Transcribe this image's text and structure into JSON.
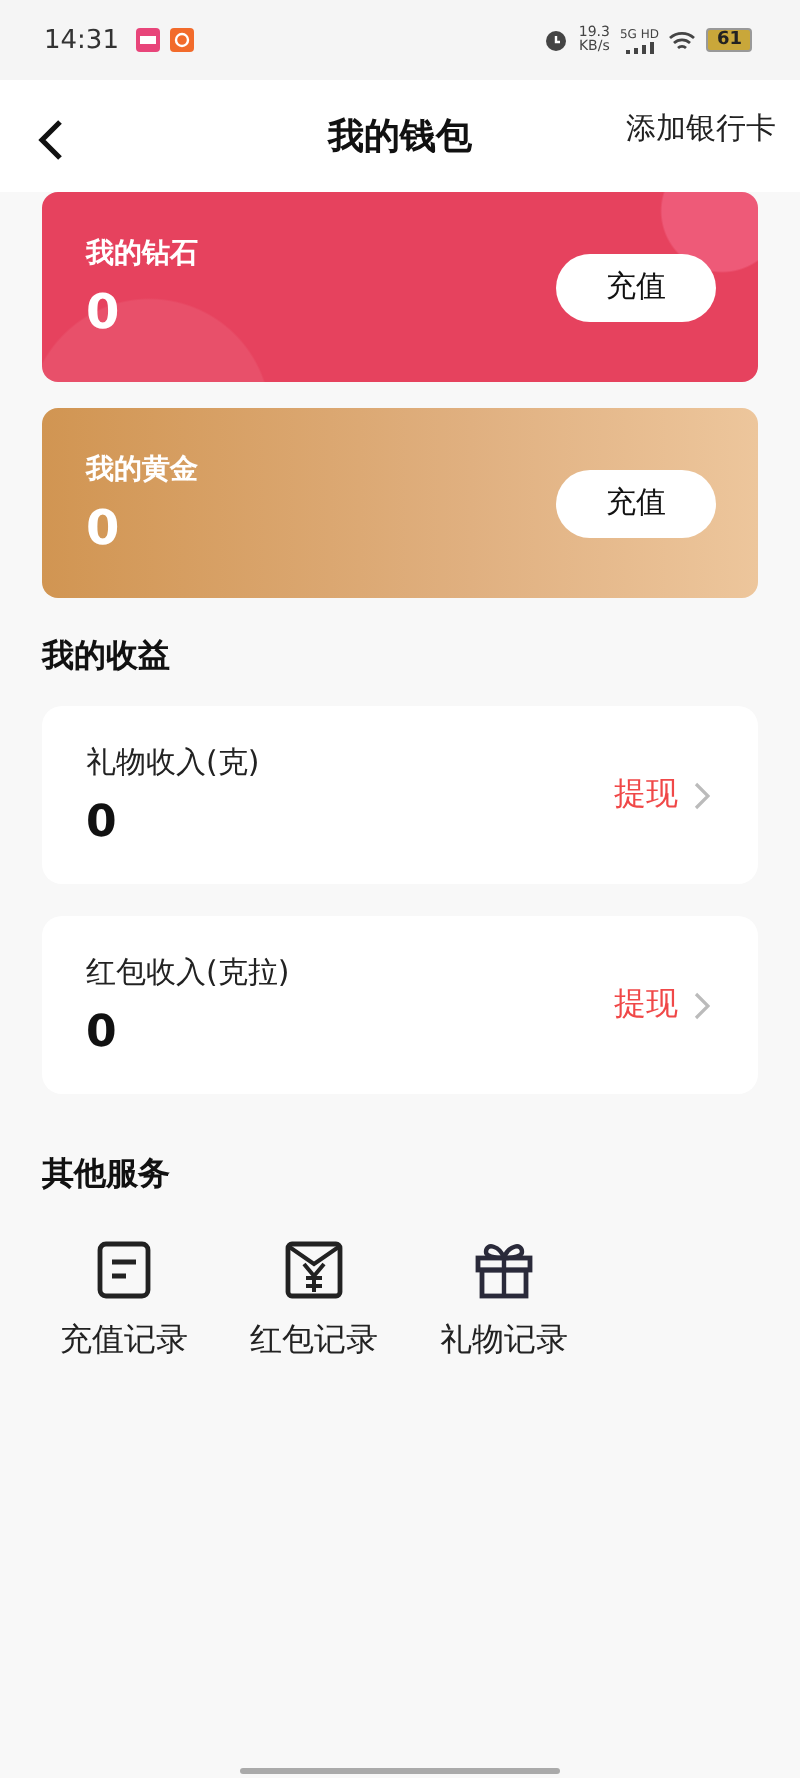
{
  "status_bar": {
    "time": "14:31",
    "speed": "19.3",
    "speed_unit": "KB/s",
    "network": "5G HD",
    "battery": "61"
  },
  "header": {
    "title": "我的钱包",
    "action": "添加银行卡"
  },
  "balance_cards": [
    {
      "kind": "diamond",
      "label": "我的钻石",
      "value": "0",
      "button": "充值"
    },
    {
      "kind": "gold",
      "label": "我的黄金",
      "value": "0",
      "button": "充值"
    }
  ],
  "earnings": {
    "title": "我的收益",
    "items": [
      {
        "label": "礼物收入(克)",
        "value": "0",
        "action": "提现"
      },
      {
        "label": "红包收入(克拉)",
        "value": "0",
        "action": "提现"
      }
    ]
  },
  "services": {
    "title": "其他服务",
    "items": [
      {
        "kind": "recharge",
        "label": "充值记录"
      },
      {
        "kind": "envelope",
        "label": "红包记录"
      },
      {
        "kind": "gift",
        "label": "礼物记录"
      }
    ]
  }
}
